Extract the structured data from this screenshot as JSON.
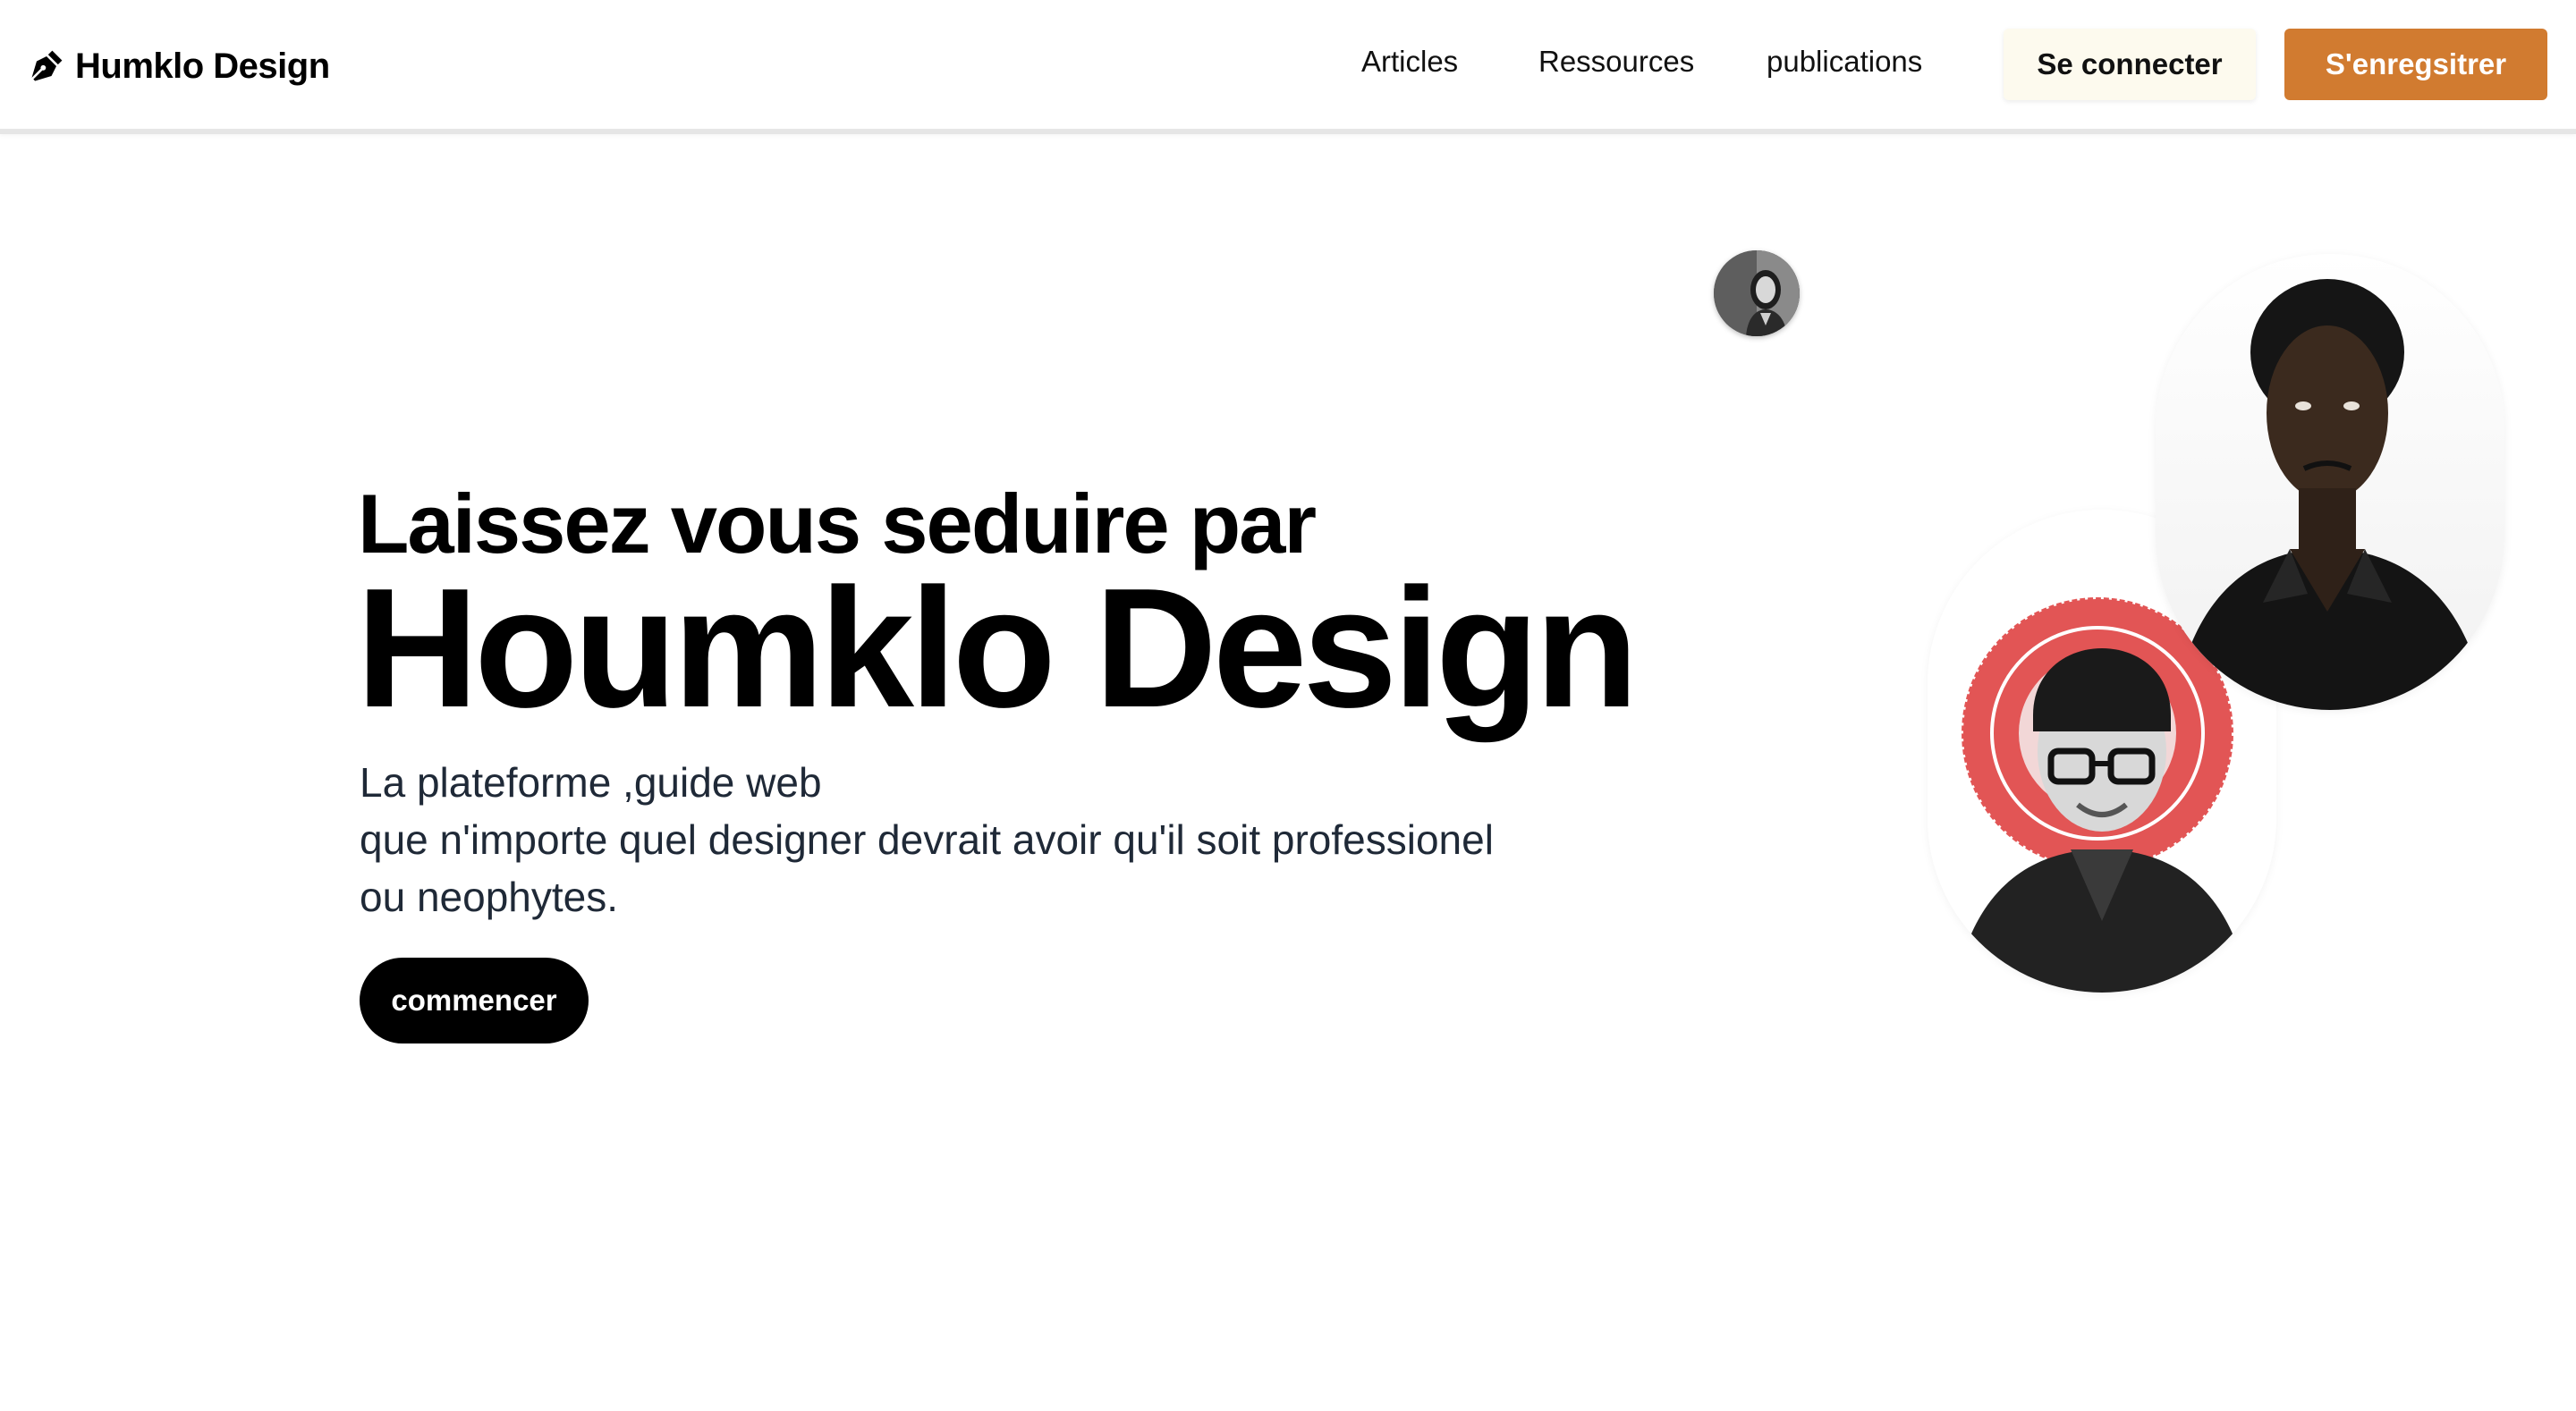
{
  "navbar": {
    "brand": {
      "icon": "pen-nib-icon",
      "name": "Humklo Design"
    },
    "links": [
      {
        "label": "Articles"
      },
      {
        "label": "Ressources"
      },
      {
        "label": "publications"
      }
    ],
    "login_label": "Se connecter",
    "register_label": "S'enregsitrer"
  },
  "hero": {
    "pre_title": "Laissez vous seduire par",
    "title": "Houmklo Design",
    "subtitle_lines": [
      "La plateforme ,guide web",
      "que n'importe quel designer devrait avoir qu'il soit professionel",
      "ou neophytes."
    ],
    "cta_label": "commencer"
  },
  "colors": {
    "accent": "#d17b30",
    "login_bg": "#fdfaee",
    "cta_bg": "#000000"
  }
}
